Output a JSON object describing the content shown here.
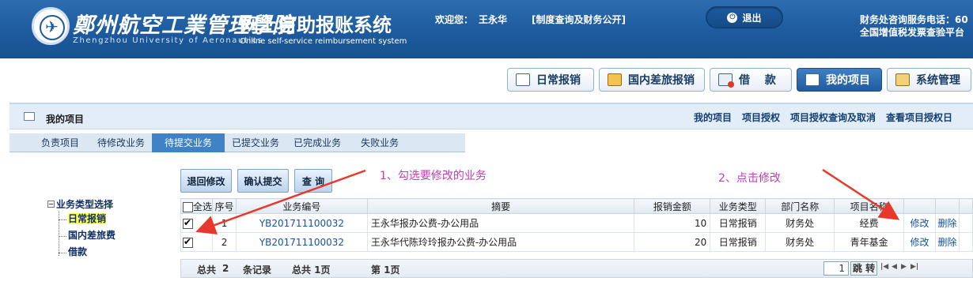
{
  "banner": {
    "school_cn": "鄭州航空工業管理學院",
    "school_en": "Zhengzhou University of Aeronautics",
    "system_title": "网上自助报账系统",
    "system_subtitle": "Online self-service reimbursement system",
    "welcome_label": "欢迎您：",
    "user_name": "王永华",
    "policy_link": "[制度查询及财务公开]",
    "logout_label": "退出",
    "phone_text": "财务处咨询服务电话：60",
    "invoice_text": "全国增值税发票查验平台"
  },
  "modules": [
    {
      "label": "日常报销"
    },
    {
      "label": "国内差旅报销"
    },
    {
      "label": "借　 款"
    },
    {
      "label": "我的项目"
    },
    {
      "label": "系统管理"
    }
  ],
  "page": {
    "title": "我的项目",
    "links": [
      "我的项目",
      "项目授权",
      "项目授权查询及取消",
      "查看项目授权日"
    ]
  },
  "subtabs": [
    "负责项目",
    "待修改业务",
    "待提交业务",
    "已提交业务",
    "已完成业务",
    "失败业务"
  ],
  "tree": {
    "root": "业务类型选择",
    "items": [
      "日常报销",
      "国内差旅费",
      "借款"
    ]
  },
  "actions": {
    "return_label": "退回修改",
    "confirm_label": "确认提交",
    "query_label": "查 询"
  },
  "grid": {
    "headers": {
      "select_all": "全选",
      "index": "序号",
      "code": "业务编号",
      "summary": "摘要",
      "amount": "报销金额",
      "type": "业务类型",
      "dept": "部门名称",
      "project": "项目名称"
    },
    "rows": [
      {
        "checked": true,
        "index": "1",
        "code": "YB201711100032",
        "summary": "王永华报办公费-办公用品",
        "amount": "10",
        "type": "日常报销",
        "dept": "财务处",
        "project": "经费",
        "edit": "修改",
        "delete": "删除"
      },
      {
        "checked": true,
        "index": "2",
        "code": "YB201711100032",
        "summary": "王永华代陈玲玲报办公费-办公用品",
        "amount": "20",
        "type": "日常报销",
        "dept": "财务处",
        "project": "青年基金",
        "edit": "修改",
        "delete": "删除"
      }
    ]
  },
  "pager": {
    "total_label": "总共",
    "total_count": "2",
    "records_label": "条记录",
    "pages_text": "总共 1页",
    "current_text": "第 1页",
    "page_input": "1",
    "go_label": "跳 转"
  },
  "annotations": {
    "step1": "1、勾选要修改的业务",
    "step2": "2、点击修改"
  },
  "colors": {
    "banner": "#1d5a9e",
    "active_tab": "#3f82c6",
    "annotation": "#c23bb7",
    "arrow": "#e8382c",
    "tree_selected_bg": "#ffff55"
  }
}
